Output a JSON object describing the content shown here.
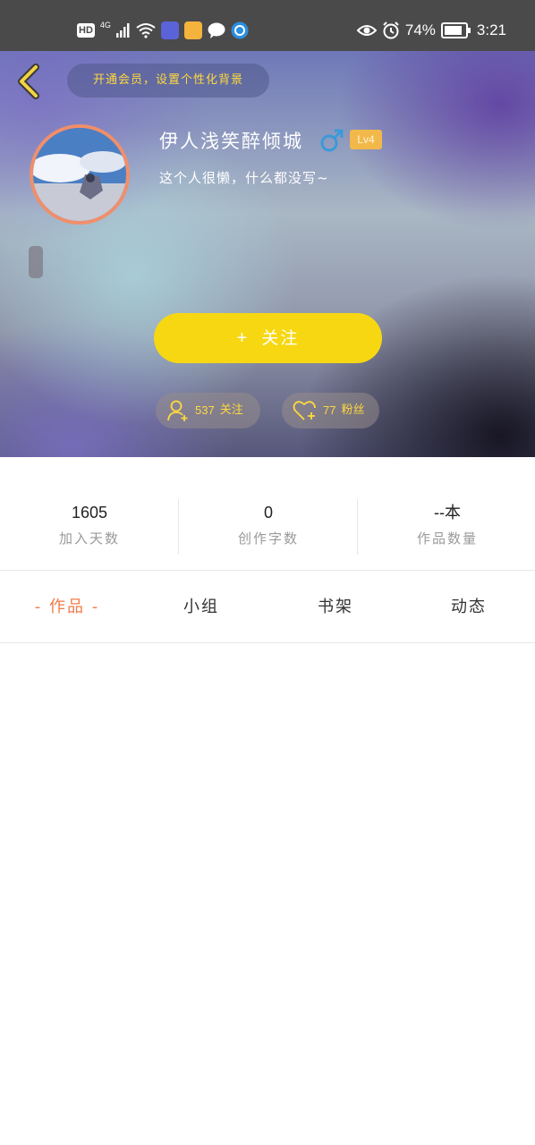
{
  "status_bar": {
    "hd": "HD",
    "network": "4G",
    "battery_percent": "74%",
    "time": "3:21"
  },
  "header": {
    "vip_banner": "开通会员，设置个性化背景",
    "username": "伊人浅笑醉倾城",
    "gender_symbol": "♂",
    "level": "Lv4",
    "bio": "这个人很懒，什么都没写~",
    "follow_button": "关注",
    "follow_plus": "+",
    "following": {
      "count": "537",
      "label": "关注"
    },
    "fans": {
      "count": "77",
      "label": "粉丝"
    }
  },
  "stats": [
    {
      "value": "1605",
      "label": "加入天数"
    },
    {
      "value": "0",
      "label": "创作字数"
    },
    {
      "value": "--本",
      "label": "作品数量"
    }
  ],
  "tabs": [
    {
      "label": "- 作品 -",
      "active": true
    },
    {
      "label": "小组",
      "active": false
    },
    {
      "label": "书架",
      "active": false
    },
    {
      "label": "动态",
      "active": false
    }
  ],
  "colors": {
    "accent_yellow": "#f7d712",
    "active_tab": "#f07c4b",
    "level_badge": "#f2b84a",
    "gender_blue": "#3a9ad9"
  }
}
